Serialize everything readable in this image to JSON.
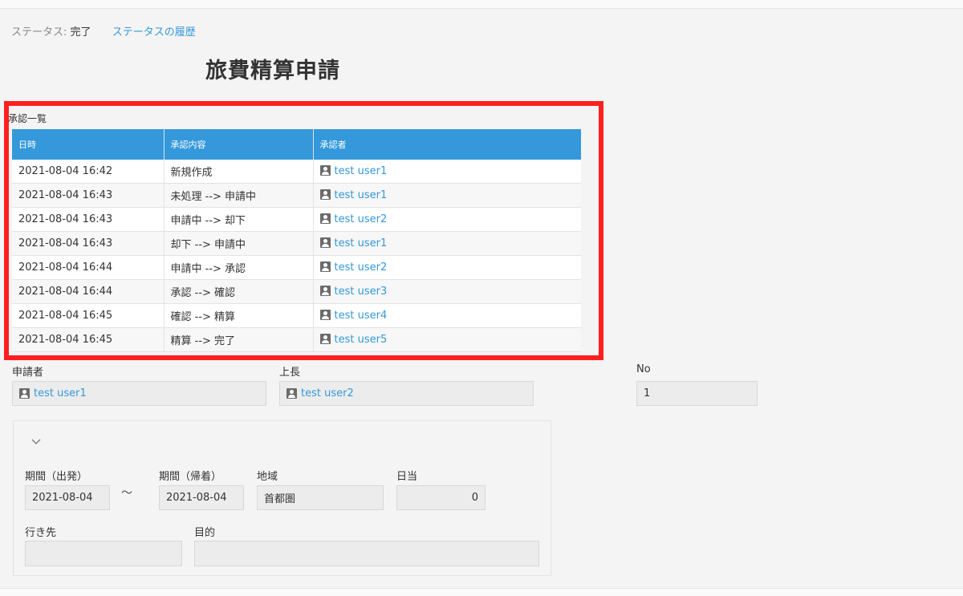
{
  "status": {
    "label": "ステータス:",
    "value": "完了",
    "history_link": "ステータスの履歴"
  },
  "page_title": "旅費精算申請",
  "approval_list": {
    "label": "承認一覧",
    "headers": {
      "date": "日時",
      "content": "承認内容",
      "approver": "承認者"
    },
    "rows": [
      {
        "date": "2021-08-04 16:42",
        "content": "新規作成",
        "approver": "test user1"
      },
      {
        "date": "2021-08-04 16:43",
        "content": "未処理 --> 申請中",
        "approver": "test user1"
      },
      {
        "date": "2021-08-04 16:43",
        "content": "申請中 --> 却下",
        "approver": "test user2"
      },
      {
        "date": "2021-08-04 16:43",
        "content": "却下 --> 申請中",
        "approver": "test user1"
      },
      {
        "date": "2021-08-04 16:44",
        "content": "申請中 --> 承認",
        "approver": "test user2"
      },
      {
        "date": "2021-08-04 16:44",
        "content": "承認 --> 確認",
        "approver": "test user3"
      },
      {
        "date": "2021-08-04 16:45",
        "content": "確認 --> 精算",
        "approver": "test user4"
      },
      {
        "date": "2021-08-04 16:45",
        "content": "精算 --> 完了",
        "approver": "test user5"
      }
    ]
  },
  "fields": {
    "applicant": {
      "label": "申請者",
      "value": "test user1"
    },
    "supervisor": {
      "label": "上長",
      "value": "test user2"
    },
    "no": {
      "label": "No",
      "value": "1"
    }
  },
  "trip": {
    "start": {
      "label": "期間（出発）",
      "value": "2021-08-04"
    },
    "tilde": "～",
    "end": {
      "label": "期間（帰着）",
      "value": "2021-08-04"
    },
    "region": {
      "label": "地域",
      "value": "首都圏"
    },
    "allowance": {
      "label": "日当",
      "value": "0"
    },
    "destination": {
      "label": "行き先",
      "value": ""
    },
    "purpose": {
      "label": "目的",
      "value": ""
    }
  },
  "icons": {
    "user": "user-icon",
    "chevron": "chevron-down-icon"
  },
  "colors": {
    "accent": "#3498db",
    "highlight": "#ff1f1f"
  }
}
